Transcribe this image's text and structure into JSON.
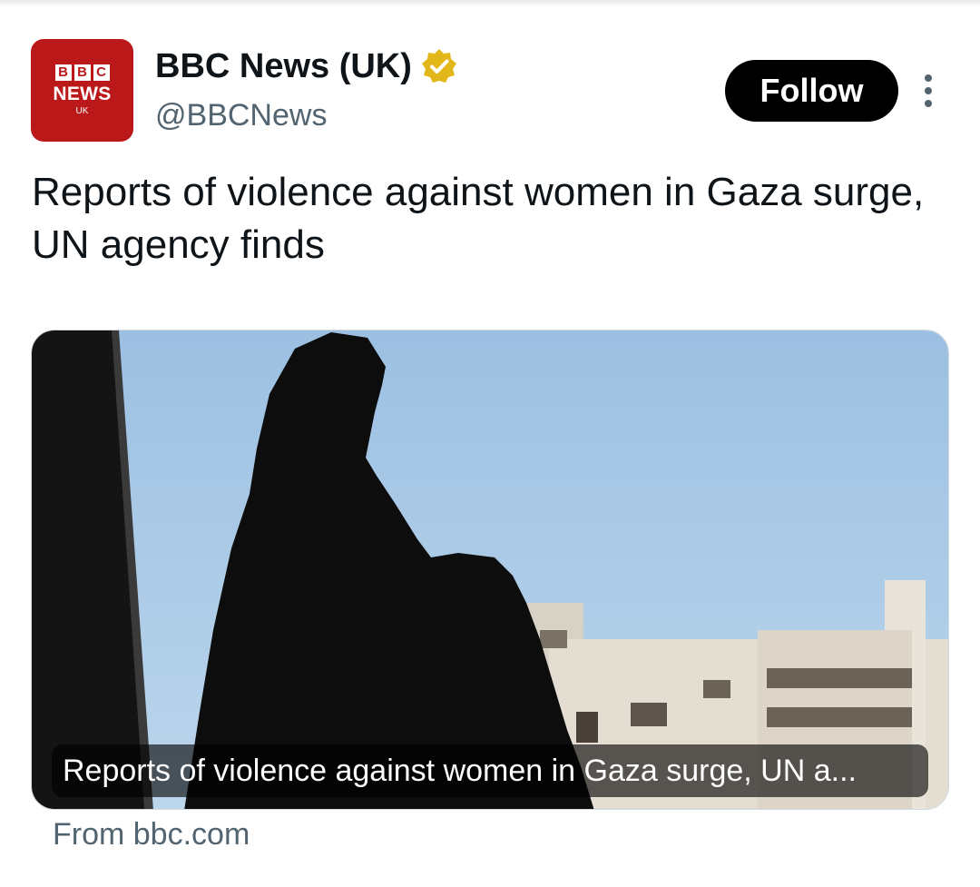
{
  "author": {
    "avatar": {
      "logo_letters": [
        "B",
        "B",
        "C"
      ],
      "logo_word": "NEWS",
      "logo_region": "UK",
      "background": "#bb1919"
    },
    "display_name": "BBC News (UK)",
    "verified_badge": "gold-verified-icon",
    "handle": "@BBCNews"
  },
  "follow_label": "Follow",
  "more_icon": "more-vertical-icon",
  "tweet_text": "Reports of violence against women in Gaza surge, UN agency finds",
  "link_card": {
    "caption": "Reports of violence against women in Gaza surge, UN a...",
    "source": "From bbc.com"
  },
  "colors": {
    "text_primary": "#0f1419",
    "text_secondary": "#536471",
    "follow_bg": "#000000",
    "verified_gold": "#e2b719"
  }
}
